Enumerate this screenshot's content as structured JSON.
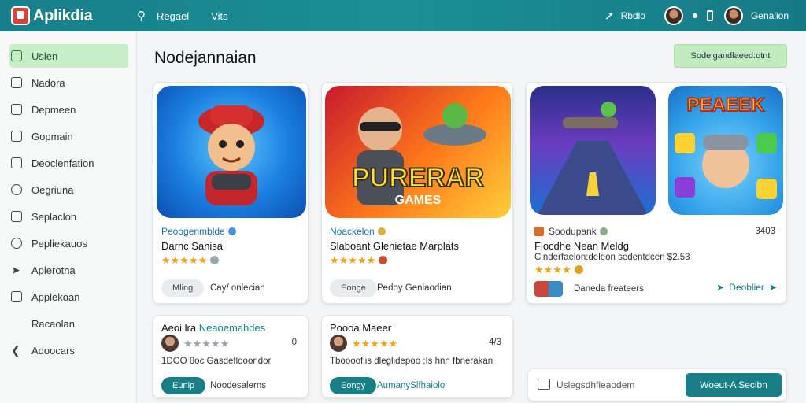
{
  "app": {
    "logo_text": "Aplikdia"
  },
  "header": {
    "nav": [
      {
        "label": "Regael"
      },
      {
        "label": "Vits"
      }
    ],
    "right_link": "Rbdlo",
    "user_name": "Genalion"
  },
  "sidebar": {
    "items": [
      {
        "label": "Uslen",
        "icon": "document-icon",
        "active": true
      },
      {
        "label": "Nadora",
        "icon": "edit-icon"
      },
      {
        "label": "Depmeen",
        "icon": "grid-icon"
      },
      {
        "label": "Gopmain",
        "icon": "box-icon"
      },
      {
        "label": "Deoclenfation",
        "icon": "list-icon"
      },
      {
        "label": "Oegriuna",
        "icon": "circle-icon"
      },
      {
        "label": "Seplaclon",
        "icon": "search-icon"
      },
      {
        "label": "Pepliekauos",
        "icon": "tag-icon"
      },
      {
        "label": "Aplerotna",
        "icon": "send-icon"
      },
      {
        "label": "Applekoan",
        "icon": "pen-icon"
      },
      {
        "label": "Racaolan",
        "icon": "none"
      },
      {
        "label": "Adoocars",
        "icon": "share-icon"
      }
    ]
  },
  "main": {
    "title": "Nodejannaian",
    "top_action": "Sodelgandlaeed:otnt",
    "cards": [
      {
        "dev": "Peoogenmblde",
        "title": "Darnc Sanisa",
        "stars": "★★★★★",
        "tag": "Mling",
        "meta": "Cay/ onlecian"
      },
      {
        "dev": "Noackelon",
        "title": "Slaboant Glenietae Marplats",
        "stars": "★★★★★",
        "tag": "Eonge",
        "meta": "Pedoy Genlaodian",
        "thumb_text": "PURERAR",
        "thumb_sub": "GAMES"
      },
      {
        "dev": "Soodupank",
        "title": "Flocdhe Nean Meldg",
        "desc": "Clnderfaelon:deleon sedentdcen $2.53",
        "stars": "★★★★",
        "meta": "Daneda freateers",
        "count": "3403",
        "link": "Deoblier",
        "thumb2_text": "PEAEEK"
      },
      {
        "title_prefix": "Aeoi lra",
        "title_highlight": "Neaoemahdes",
        "stars": "★★★★★",
        "count": "0",
        "desc": "1DOO 8oc Gasdeflooondor",
        "tag": "Eunip",
        "meta": "Noodesalerns"
      },
      {
        "title": "Poooa Maeer",
        "stars": "★★★★★",
        "count": "4/3",
        "desc": "Tbooooflis dleglidepoo ;Is hnn fbnerakan",
        "tag": "Eongy",
        "meta": "AumanySlfhaiolo"
      }
    ],
    "footer_card": {
      "input_text": "Uslegsdhfieaodem",
      "button_label": "Woeut-A Secibn"
    }
  },
  "colors": {
    "brand": "#177f85",
    "active_bg": "#c8efc8",
    "star": "#f0a419"
  }
}
